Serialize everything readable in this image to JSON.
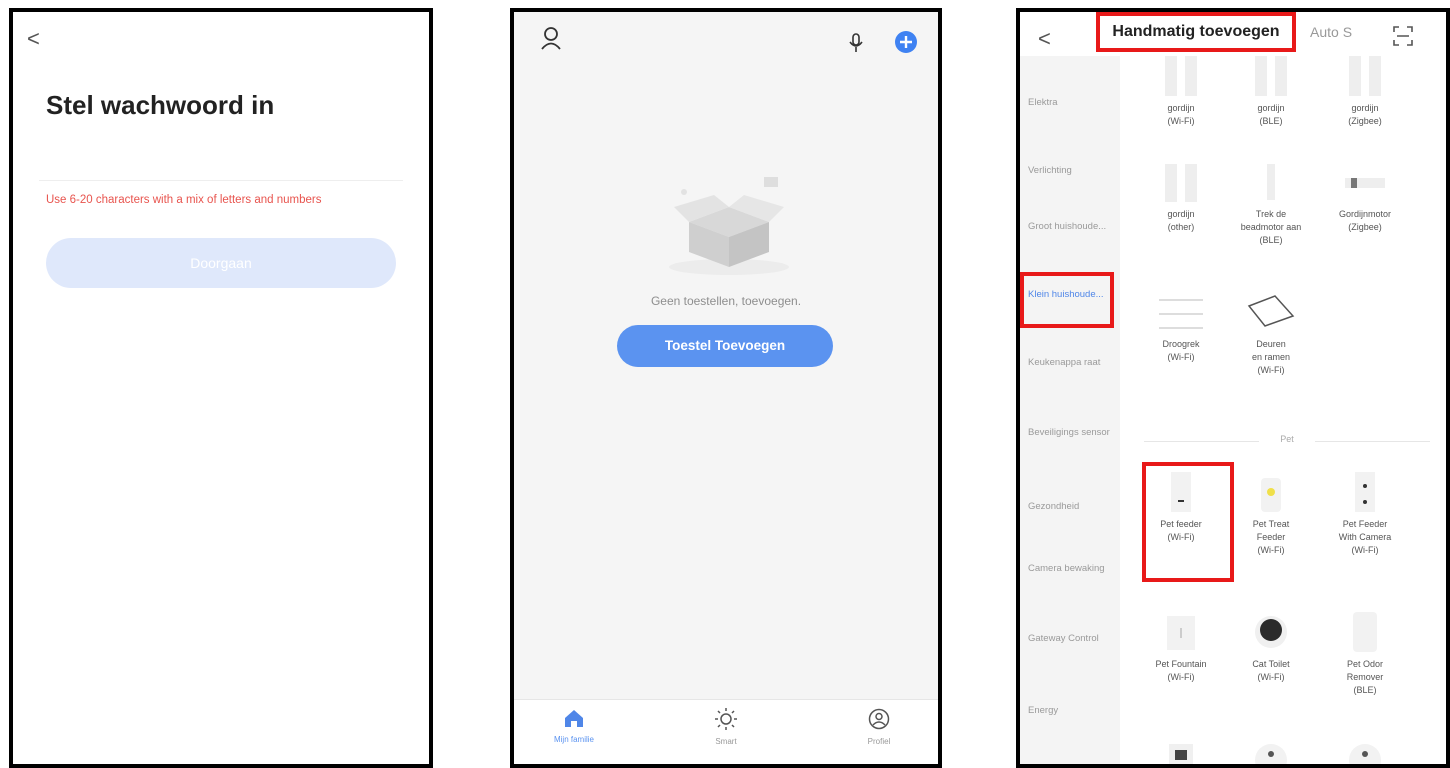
{
  "panel1": {
    "back": "<",
    "title": "Stel wachwoord in",
    "hint": "Use 6-20 characters with a mix of letters and numbers",
    "button": "Doorgaan"
  },
  "panel2": {
    "empty_text": "Geen toestellen, toevoegen.",
    "add_button": "Toestel Toevoegen",
    "tabs": [
      {
        "label": "Mijn familie",
        "icon": "home-icon"
      },
      {
        "label": "Smart",
        "icon": "sun-icon"
      },
      {
        "label": "Profiel",
        "icon": "profile-icon"
      }
    ],
    "accent": "#5b93f0"
  },
  "panel3": {
    "back": "<",
    "tab_manual": "Handmatig toevoegen",
    "tab_auto": "Auto S",
    "sidebar": [
      "Elektra",
      "Verlichting",
      "Groot huishoude...",
      "Klein huishoude...",
      "Keukenappa raat",
      "Beveiligings sensor",
      "Gezondheid",
      "Camera bewaking",
      "Gateway Control",
      "Energy"
    ],
    "devices": [
      {
        "name": "gordijn\n(Wi-Fi)"
      },
      {
        "name": "gordijn\n(BLE)"
      },
      {
        "name": "gordijn\n(Zigbee)"
      },
      {
        "name": "gordijn\n(other)"
      },
      {
        "name": "Trek de\nbeadmotor aan\n(BLE)"
      },
      {
        "name": "Gordijnmotor\n(Zigbee)"
      },
      {
        "name": "Droogrek\n(Wi-Fi)"
      },
      {
        "name": "Deuren\nen ramen\n(Wi-Fi)"
      },
      {
        "name": "Pet feeder\n(Wi-Fi)"
      },
      {
        "name": "Pet Treat\nFeeder\n(Wi-Fi)"
      },
      {
        "name": "Pet Feeder\nWith Camera\n(Wi-Fi)"
      },
      {
        "name": "Pet Fountain\n(Wi-Fi)"
      },
      {
        "name": "Cat Toilet\n(Wi-Fi)"
      },
      {
        "name": "Pet Odor\nRemover\n(BLE)"
      }
    ],
    "section_pet": "Pet",
    "highlight_color": "#e81919"
  }
}
